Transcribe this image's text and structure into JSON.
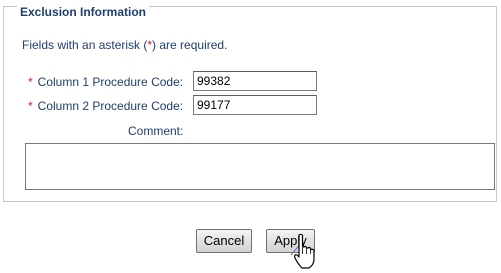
{
  "section": {
    "legend": "Exclusion Information",
    "note_before": "Fields with an asterisk (",
    "note_asterisk": "*",
    "note_after": ") are required."
  },
  "fields": {
    "column1": {
      "asterisk": "*",
      "label": "Column 1 Procedure Code:",
      "value": "99382"
    },
    "column2": {
      "asterisk": "*",
      "label": "Column 2 Procedure Code:",
      "value": "99177"
    },
    "comment": {
      "label": "Comment:",
      "value": ""
    }
  },
  "buttons": {
    "cancel_label": "Cancel",
    "apply_label": "Apply"
  },
  "cursor": {
    "icon": "hand-cursor-icon",
    "over": "apply-button"
  },
  "colors": {
    "label_text": "#1f3f6e",
    "asterisk": "#cc1f1f",
    "border": "#c9c9c9"
  }
}
